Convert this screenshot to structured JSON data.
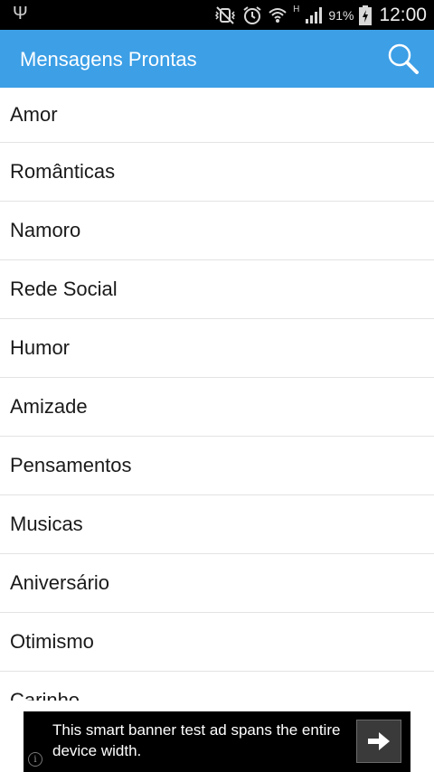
{
  "status_bar": {
    "battery_percent": "91%",
    "time": "12:00",
    "network_type": "H",
    "icons": [
      "usb-icon",
      "mute-vibrate-icon",
      "alarm-icon",
      "wifi-icon",
      "signal-icon",
      "battery-charging-icon"
    ]
  },
  "action_bar": {
    "title": "Mensagens Prontas",
    "search_icon": "search-icon",
    "color": "#3d9fe6"
  },
  "categories": [
    "Amor",
    "Românticas",
    "Namoro",
    "Rede Social",
    "Humor",
    "Amizade",
    "Pensamentos",
    "Musicas",
    "Aniversário",
    "Otimismo",
    "Carinho"
  ],
  "ad": {
    "text": "This smart banner test ad spans the entire device width.",
    "arrow_icon": "arrow-right-icon",
    "info_icon": "info-icon"
  }
}
